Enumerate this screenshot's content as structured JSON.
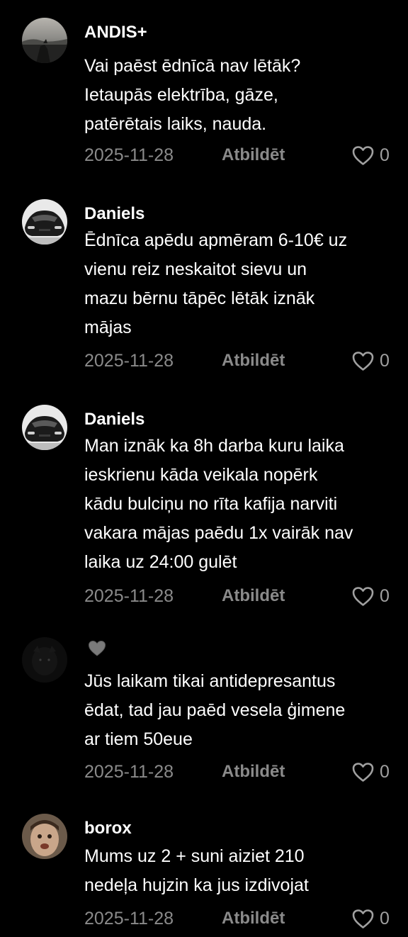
{
  "comments": [
    {
      "avatar": "avatar-lake-landscape",
      "username": "ANDIS+",
      "lines": [
        "Vai paēst ēdnīcā nav lētāk?",
        "Ietaupās elektrība, gāze,",
        "patērētais laiks, nauda."
      ],
      "date": "2025-11-28",
      "reply_label": "Atbildēt",
      "likes": "0"
    },
    {
      "avatar": "avatar-car",
      "username": "Daniels",
      "lines": [
        "Ēdnīca apēdu apmēram 6-10€ uz",
        "vienu reiz neskaitot sievu un",
        "mazu bērnu tāpēc lētāk iznāk",
        "mājas"
      ],
      "date": "2025-11-28",
      "reply_label": "Atbildēt",
      "likes": "0"
    },
    {
      "avatar": "avatar-car",
      "username": "Daniels",
      "lines": [
        "Man iznāk ka 8h darba kuru laika",
        "ieskrienu kāda veikala nopērk",
        "kādu bulciņu no rīta kafija narviti",
        "vakara mājas paēdu 1x vairāk nav",
        "laika uz 24:00 gulēt"
      ],
      "date": "2025-11-28",
      "reply_label": "Atbildēt",
      "likes": "0"
    },
    {
      "avatar": "avatar-dark-animal",
      "username_icon": "grey-heart-emoji-icon",
      "lines": [
        "Jūs laikam tikai antidepresantus",
        "ēdat, tad jau paēd vesela ģimene",
        "ar tiem 50eue"
      ],
      "date": "2025-11-28",
      "reply_label": "Atbildēt",
      "likes": "0"
    },
    {
      "avatar": "avatar-face",
      "username": "borox",
      "lines": [
        "Mums uz 2 + suni aiziet 210",
        "nedeļa hujzin ka jus izdivojat"
      ],
      "date": "2025-11-28",
      "reply_label": "Atbildēt",
      "likes": "0"
    }
  ],
  "colors": {
    "background": "#000000",
    "text": "#ffffff",
    "meta": "#8a8a8a"
  }
}
